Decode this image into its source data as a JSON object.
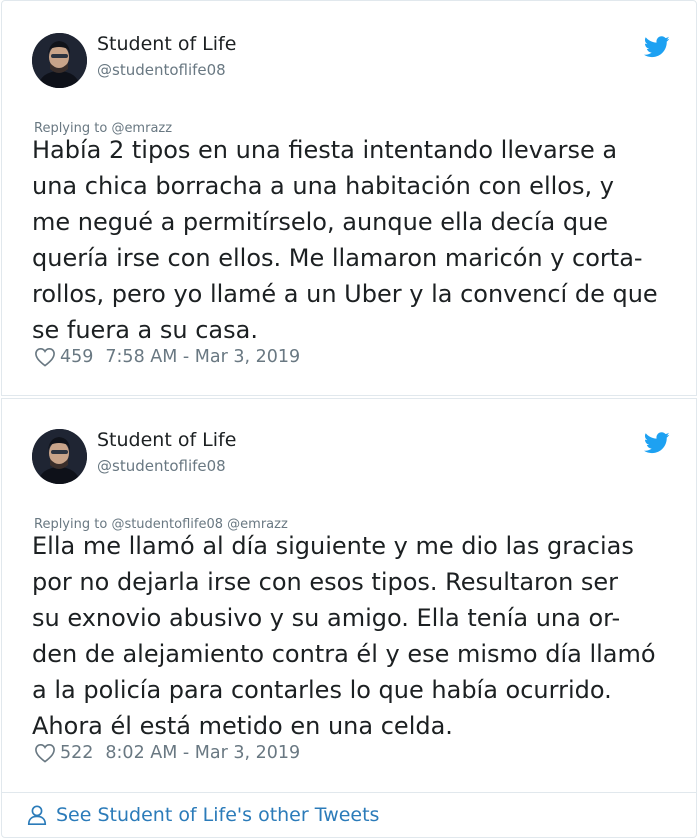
{
  "tweets": [
    {
      "author_name": "Student of Life",
      "author_handle": "@studentoflife08",
      "replying_prefix": "Replying to",
      "replying_to": [
        "@emrazz"
      ],
      "text_lines": [
        "Había 2 tipos en una fiesta intentando llevarse a",
        "una chica borracha a una habitación con ellos, y",
        "me negué a permitírselo, aunque ella decía que",
        "quería irse con ellos. Me llamaron maricón y corta-",
        "rollos, pero yo llamé a un Uber y la convencí de que",
        "se fuera a su casa."
      ],
      "likes": "459",
      "timestamp": "7:58 AM - Mar 3, 2019"
    },
    {
      "author_name": "Student of Life",
      "author_handle": "@studentoflife08",
      "replying_prefix": "Replying to",
      "replying_to": [
        "@studentoflife08",
        "@emrazz"
      ],
      "text_lines": [
        "Ella me llamó al día siguiente y me dio las gracias",
        "por no dejarla irse con esos tipos. Resultaron ser",
        "su exnovio abusivo y su amigo. Ella tenía una or-",
        "den de alejamiento contra él y ese mismo día llamó",
        "a la policía para contarles lo que había ocurrido.",
        "Ahora él está metido en una celda."
      ],
      "likes": "522",
      "timestamp": "8:02 AM - Mar 3, 2019"
    }
  ],
  "footer": {
    "label": "See Student of Life's other Tweets",
    "icon": "person-icon"
  },
  "icons": {
    "brand": "twitter-bird-icon",
    "like": "heart-icon"
  },
  "colors": {
    "twitter_blue": "#1da1f2",
    "link_blue": "#2b7bb9",
    "muted_gray": "#697882",
    "text_dark": "#1c2022",
    "border": "#e1e8ed"
  }
}
